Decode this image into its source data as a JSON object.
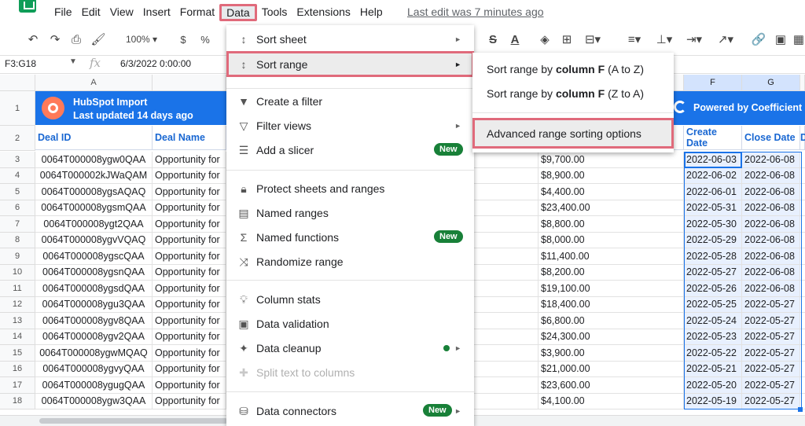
{
  "menubar": {
    "items": [
      "File",
      "Edit",
      "View",
      "Insert",
      "Format",
      "Data",
      "Tools",
      "Extensions",
      "Help"
    ],
    "last_edit": "Last edit was 7 minutes ago"
  },
  "toolbar": {
    "zoom": "100%",
    "currency": "$",
    "percent": "%"
  },
  "formula_bar": {
    "name_box": "F3:G18",
    "fx": "fx",
    "value": "6/3/2022 0:00:00"
  },
  "grid": {
    "col_headers": [
      "A",
      "F",
      "G"
    ],
    "row_numbers": [
      "1",
      "2",
      "3",
      "4",
      "5",
      "6",
      "7",
      "8",
      "9",
      "10",
      "11",
      "12",
      "13",
      "14",
      "15",
      "16",
      "17",
      "18"
    ],
    "banner": {
      "title": "HubSpot Import",
      "subtitle": "Last updated 14 days ago",
      "powered": "Powered by Coefficient"
    },
    "headers": {
      "deal_id": "Deal ID",
      "deal_name": "Deal Name",
      "create_date": "Create Date",
      "close_date": "Close Date",
      "next_col": "D"
    },
    "rows": [
      {
        "id": "0064T000008ygw0QAA",
        "name": "Opportunity for",
        "amount": "$9,700.00",
        "create": "2022-06-03",
        "close": "2022-06-08"
      },
      {
        "id": "0064T000002kJWaQAM",
        "name": "Opportunity for",
        "amount": "$8,900.00",
        "create": "2022-06-02",
        "close": "2022-06-08"
      },
      {
        "id": "0064T000008ygsAQAQ",
        "name": "Opportunity for",
        "amount": "$4,400.00",
        "create": "2022-06-01",
        "close": "2022-06-08"
      },
      {
        "id": "0064T000008ygsmQAA",
        "name": "Opportunity for",
        "amount": "$23,400.00",
        "create": "2022-05-31",
        "close": "2022-06-08"
      },
      {
        "id": "0064T000008ygt2QAA",
        "name": "Opportunity for",
        "amount": "$8,800.00",
        "create": "2022-05-30",
        "close": "2022-06-08"
      },
      {
        "id": "0064T000008ygvVQAQ",
        "name": "Opportunity for",
        "amount": "$8,000.00",
        "create": "2022-05-29",
        "close": "2022-06-08"
      },
      {
        "id": "0064T000008ygscQAA",
        "name": "Opportunity for",
        "amount": "$11,400.00",
        "create": "2022-05-28",
        "close": "2022-06-08"
      },
      {
        "id": "0064T000008ygsnQAA",
        "name": "Opportunity for",
        "amount": "$8,200.00",
        "create": "2022-05-27",
        "close": "2022-06-08"
      },
      {
        "id": "0064T000008ygsdQAA",
        "name": "Opportunity for",
        "amount": "$19,100.00",
        "create": "2022-05-26",
        "close": "2022-06-08"
      },
      {
        "id": "0064T000008ygu3QAA",
        "name": "Opportunity for",
        "amount": "$18,400.00",
        "create": "2022-05-25",
        "close": "2022-05-27"
      },
      {
        "id": "0064T000008ygv8QAA",
        "name": "Opportunity for",
        "amount": "$6,800.00",
        "create": "2022-05-24",
        "close": "2022-05-27"
      },
      {
        "id": "0064T000008ygv2QAA",
        "name": "Opportunity for",
        "amount": "$24,300.00",
        "create": "2022-05-23",
        "close": "2022-05-27"
      },
      {
        "id": "0064T000008ygwMQAQ",
        "name": "Opportunity for",
        "amount": "$3,900.00",
        "create": "2022-05-22",
        "close": "2022-05-27"
      },
      {
        "id": "0064T000008ygvyQAA",
        "name": "Opportunity for",
        "amount": "$21,000.00",
        "create": "2022-05-21",
        "close": "2022-05-27"
      },
      {
        "id": "0064T000008ygugQAA",
        "name": "Opportunity for",
        "amount": "$23,600.00",
        "create": "2022-05-20",
        "close": "2022-05-27"
      },
      {
        "id": "0064T000008ygw3QAA",
        "name": "Opportunity for",
        "amount": "$4,100.00",
        "create": "2022-05-19",
        "close": "2022-05-27"
      }
    ]
  },
  "data_menu": {
    "sort_sheet": "Sort sheet",
    "sort_range": "Sort range",
    "create_filter": "Create a filter",
    "filter_views": "Filter views",
    "add_slicer": "Add a slicer",
    "new_badge": "New",
    "protect": "Protect sheets and ranges",
    "named_ranges": "Named ranges",
    "named_functions": "Named functions",
    "randomize": "Randomize range",
    "column_stats": "Column stats",
    "data_validation": "Data validation",
    "data_cleanup": "Data cleanup",
    "split_text": "Split text to columns",
    "data_connectors": "Data connectors"
  },
  "sort_submenu": {
    "prefix": "Sort range by",
    "column": "column F",
    "az": "(A to Z)",
    "za": "(Z to A)",
    "advanced": "Advanced range sorting options"
  },
  "colors": {
    "highlight_border": "#e06a7b",
    "banner_blue": "#1a73e8",
    "badge_green": "#188038"
  }
}
